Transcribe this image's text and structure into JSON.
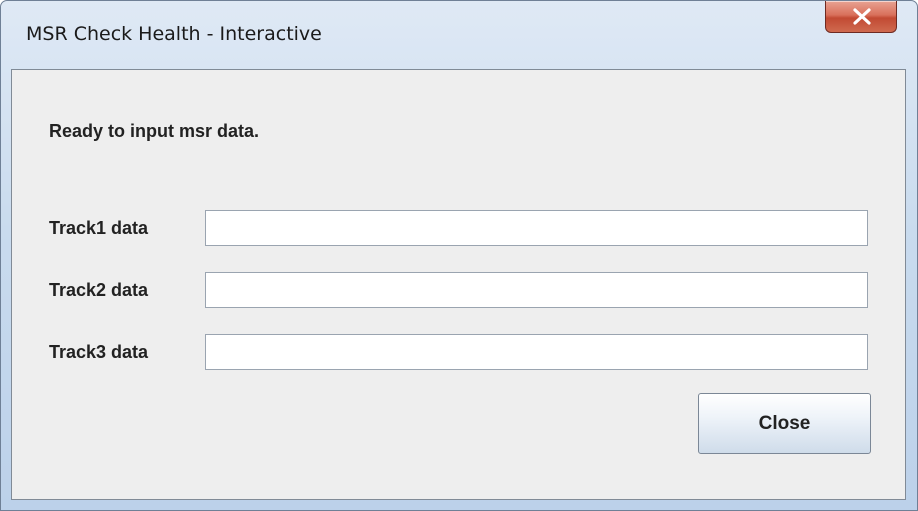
{
  "window": {
    "title": "MSR Check Health - Interactive"
  },
  "status": {
    "message": "Ready to input msr data."
  },
  "fields": [
    {
      "label": "Track1 data",
      "value": ""
    },
    {
      "label": "Track2 data",
      "value": ""
    },
    {
      "label": "Track3 data",
      "value": ""
    }
  ],
  "buttons": {
    "close_label": "Close"
  },
  "icons": {
    "titlebar_close": "close-icon"
  },
  "colors": {
    "titlebar_close_bg": "#c9503a",
    "client_bg": "#eeeeee",
    "titlebar_bg": "#c9dbee"
  }
}
